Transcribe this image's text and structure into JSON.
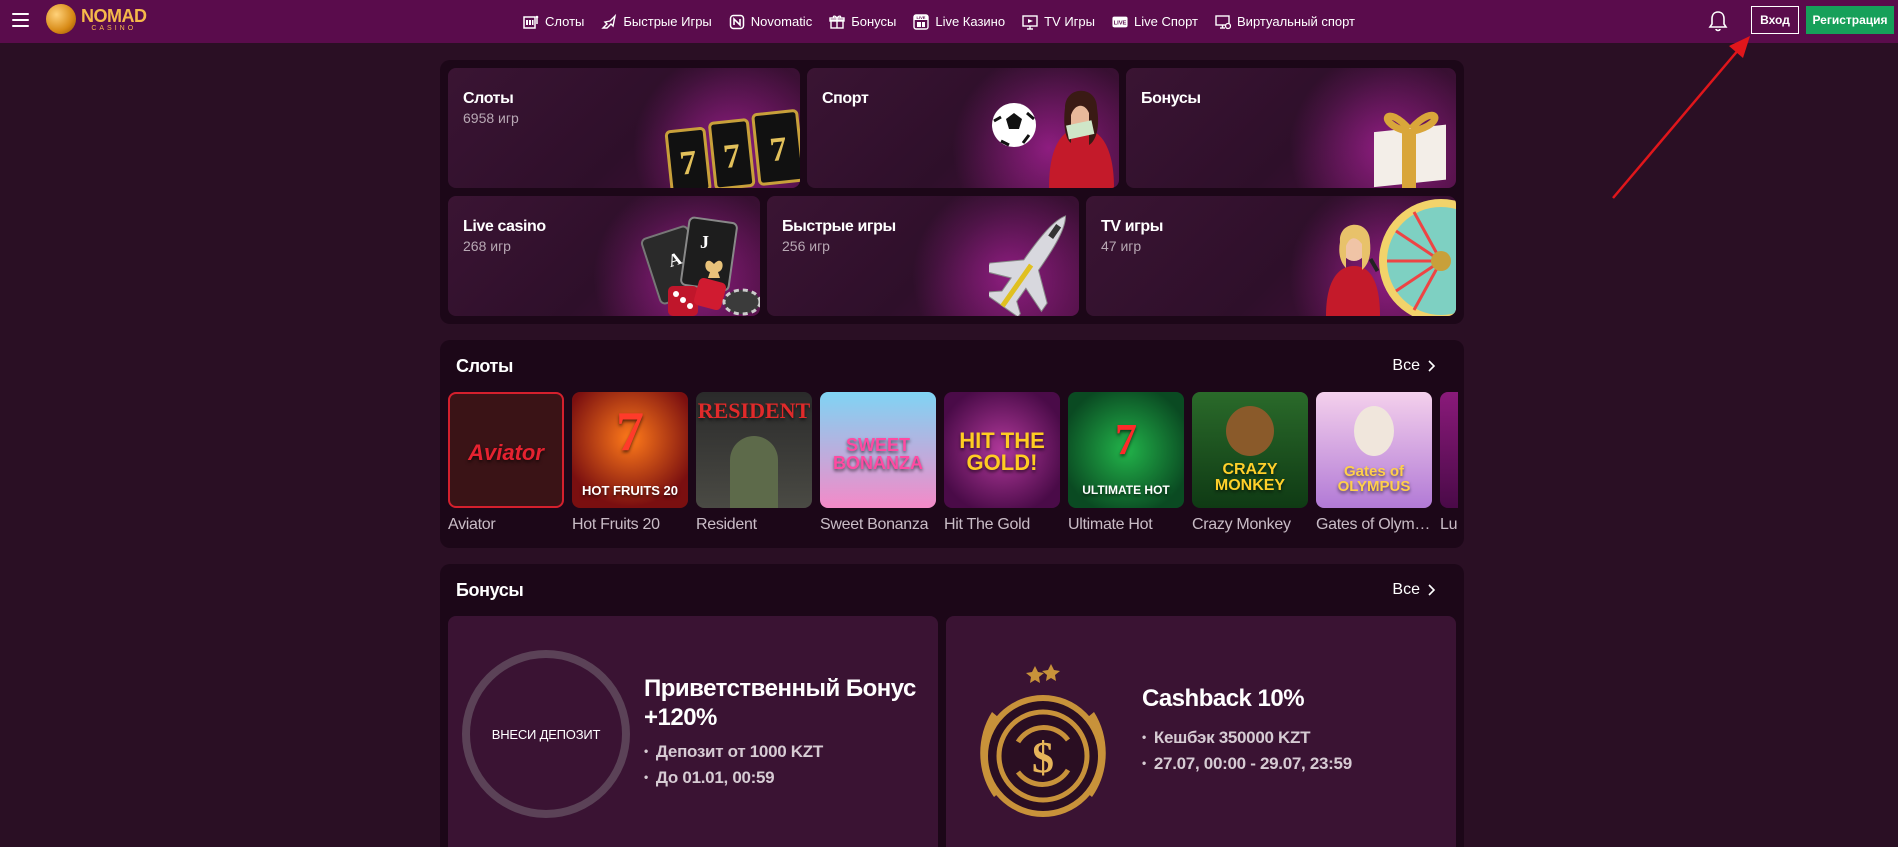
{
  "header": {
    "logo_main": "NOMAD",
    "logo_sub": "CASINO",
    "nav": [
      {
        "label": "Слоты",
        "icon": "slot-machine-icon"
      },
      {
        "label": "Быстрые Игры",
        "icon": "jet-icon"
      },
      {
        "label": "Novomatic",
        "icon": "novomatic-icon"
      },
      {
        "label": "Бонусы",
        "icon": "gift-icon"
      },
      {
        "label": "Live Казино",
        "icon": "live-cards-icon"
      },
      {
        "label": "TV Игры",
        "icon": "tv-icon"
      },
      {
        "label": "Live Спорт",
        "icon": "live-badge-icon"
      },
      {
        "label": "Виртуальный спорт",
        "icon": "monitor-icon"
      }
    ],
    "login_label": "Вход",
    "register_label": "Регистрация"
  },
  "categories": [
    {
      "title": "Слоты",
      "count": "6958 игр"
    },
    {
      "title": "Спорт",
      "count": ""
    },
    {
      "title": "Бонусы",
      "count": ""
    },
    {
      "title": "Live casino",
      "count": "268 игр"
    },
    {
      "title": "Быстрые игры",
      "count": "256 игр"
    },
    {
      "title": "TV игры",
      "count": "47 игр"
    }
  ],
  "slots": {
    "title": "Слоты",
    "see_all": "Все",
    "games": [
      {
        "name": "Aviator",
        "art": "Aviator"
      },
      {
        "name": "Hot Fruits 20",
        "art": "HOT FRUITS 20"
      },
      {
        "name": "Resident",
        "art": "RESIDENT"
      },
      {
        "name": "Sweet Bonanza",
        "art": "SWEET BONANZA"
      },
      {
        "name": "Hit The Gold",
        "art": "HIT THE GOLD!"
      },
      {
        "name": "Ultimate Hot",
        "art": "ULTIMATE HOT"
      },
      {
        "name": "Crazy Monkey",
        "art": "CRAZY MONKEY"
      },
      {
        "name": "Gates of Olympus",
        "art": "Gates of OLYMPUS"
      },
      {
        "name": "Lucky",
        "art": ""
      }
    ]
  },
  "bonuses": {
    "title": "Бонусы",
    "see_all": "Все",
    "cards": [
      {
        "ring_text": "ВНЕСИ ДЕПОЗИТ",
        "title_line1": "Приветственный Бонус",
        "title_line2": "+120%",
        "lines": [
          "Депозит от 1000 KZT",
          "До 01.01, 00:59"
        ]
      },
      {
        "title_line1": "Cashback 10%",
        "lines": [
          "Кешбэк 350000 KZT",
          "27.07, 00:00 - 29.07, 23:59"
        ]
      }
    ]
  },
  "colors": {
    "header_bg": "#5a0c4c",
    "page_bg": "#2a0f24",
    "panel_bg": "#1c0718",
    "register_green": "#16a05a",
    "annotation_arrow": "#e0161b"
  }
}
